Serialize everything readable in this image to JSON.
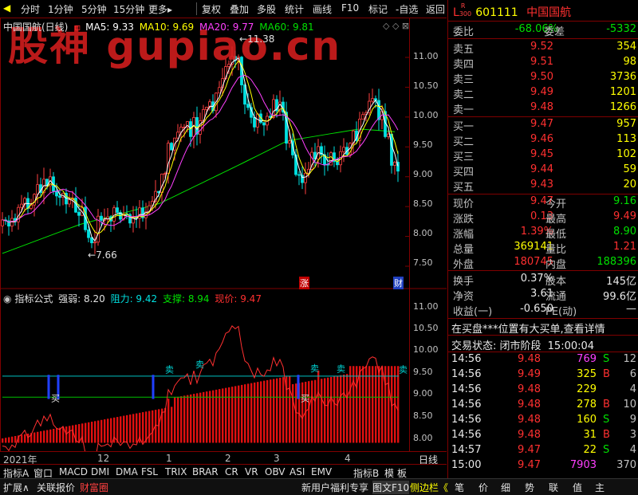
{
  "toolbar": {
    "items": [
      "分时",
      "1分钟",
      "5分钟",
      "15分钟",
      "更多▸",
      "复权",
      "叠加",
      "多股",
      "统计",
      "画线",
      "F10",
      "标记",
      "-自选",
      "返回"
    ]
  },
  "watermark": "股神 gupiao.cn",
  "header": {
    "stock_name": "中国国航(日线)",
    "ma5": "MA5: 9.33",
    "ma10": "MA10: 9.69",
    "ma20": "MA20: 9.77",
    "ma60": "MA60: 9.81",
    "colors": {
      "ma5": "#ffffff",
      "ma10": "#ffff00",
      "ma20": "#ff40ff",
      "ma60": "#00e000"
    }
  },
  "price_chart": {
    "high_label": "11.38",
    "low_label": "7.66",
    "y_ticks": [
      "11.00",
      "10.50",
      "10.00",
      "9.50",
      "9.00",
      "8.50",
      "8.00",
      "7.50"
    ],
    "zhang_tag": "涨",
    "cai_tag": "财"
  },
  "indicator": {
    "title": "指标公式",
    "strength": "强弱: 8.20",
    "resistance": "阻力: 9.42",
    "support": "支撑: 8.94",
    "current": "现价: 9.47",
    "y_ticks": [
      "11.00",
      "10.50",
      "10.00",
      "9.50",
      "9.00",
      "8.50",
      "8.00"
    ],
    "buy_label": "买",
    "sell_label": "卖"
  },
  "x_axis": {
    "labels": [
      "2021年",
      "12",
      "1",
      "2",
      "3",
      "4"
    ],
    "period": "日线"
  },
  "bottom_tabs": [
    "指标A",
    "窗口",
    "MACD",
    "DMI",
    "DMA",
    "FSL",
    "TRIX",
    "BRAR",
    "CR",
    "VR",
    "OBV",
    "ASI",
    "EMV",
    "指标B",
    "模",
    "板"
  ],
  "status_bar": {
    "left": [
      "扩展∧",
      "关联报价",
      "财富圈"
    ],
    "middle": [
      "新用户福利专享",
      "图文F10",
      "侧边栏《"
    ],
    "right": [
      "笔",
      "价",
      "细",
      "势",
      "联",
      "值",
      "主"
    ]
  },
  "quote": {
    "code_prefix": "L",
    "code_sup": "R",
    "code_sub": "300",
    "code": "601111",
    "name": "中国国航",
    "weibi_label": "委比",
    "weibi_value": "-68.06%",
    "weicha_label": "委差",
    "weicha_value": "-5332",
    "asks": [
      {
        "label": "卖五",
        "price": "9.52",
        "vol": "354"
      },
      {
        "label": "卖四",
        "price": "9.51",
        "vol": "98"
      },
      {
        "label": "卖三",
        "price": "9.50",
        "vol": "3736"
      },
      {
        "label": "卖二",
        "price": "9.49",
        "vol": "1201"
      },
      {
        "label": "卖一",
        "price": "9.48",
        "vol": "1266"
      }
    ],
    "bids": [
      {
        "label": "买一",
        "price": "9.47",
        "vol": "957"
      },
      {
        "label": "买二",
        "price": "9.46",
        "vol": "113"
      },
      {
        "label": "买三",
        "price": "9.45",
        "vol": "102"
      },
      {
        "label": "买四",
        "price": "9.44",
        "vol": "59"
      },
      {
        "label": "买五",
        "price": "9.43",
        "vol": "20"
      }
    ],
    "stats": [
      {
        "l1": "现价",
        "v1": "9.47",
        "l2": "今开",
        "v2": "9.16"
      },
      {
        "l1": "涨跌",
        "v1": "0.13",
        "l2": "最高",
        "v2": "9.49"
      },
      {
        "l1": "涨幅",
        "v1": "1.39%",
        "l2": "最低",
        "v2": "8.90"
      },
      {
        "l1": "总量",
        "v1": "369141",
        "l2": "量比",
        "v2": "1.21"
      },
      {
        "l1": "外盘",
        "v1": "180745",
        "l2": "内盘",
        "v2": "188396"
      }
    ],
    "stats2": [
      {
        "l1": "换手",
        "v1": "0.37%",
        "l2": "股本",
        "v2": "145亿"
      },
      {
        "l1": "净资",
        "v1": "3.61",
        "l2": "流通",
        "v2": "99.6亿"
      },
      {
        "l1": "收益(一)",
        "v1": "-0.650",
        "l2": "PE(动)",
        "v2": "—"
      }
    ],
    "notice": "在买盘***位置有大买单,查看详情",
    "trade_status_label": "交易状态: 闭市阶段",
    "trade_status_time": "15:00:04",
    "ticks": [
      {
        "t": "14:56",
        "p": "9.48",
        "v": "769",
        "d": "S",
        "n": "12"
      },
      {
        "t": "14:56",
        "p": "9.49",
        "v": "325",
        "d": "B",
        "n": "6"
      },
      {
        "t": "14:56",
        "p": "9.48",
        "v": "229",
        "d": "",
        "n": "4"
      },
      {
        "t": "14:56",
        "p": "9.48",
        "v": "278",
        "d": "B",
        "n": "10"
      },
      {
        "t": "14:56",
        "p": "9.48",
        "v": "160",
        "d": "S",
        "n": "9"
      },
      {
        "t": "14:56",
        "p": "9.48",
        "v": "31",
        "d": "B",
        "n": "3"
      },
      {
        "t": "14:57",
        "p": "9.47",
        "v": "22",
        "d": "S",
        "n": "4"
      },
      {
        "t": "15:00",
        "p": "9.47",
        "v": "7903",
        "d": "",
        "n": "370"
      }
    ]
  }
}
